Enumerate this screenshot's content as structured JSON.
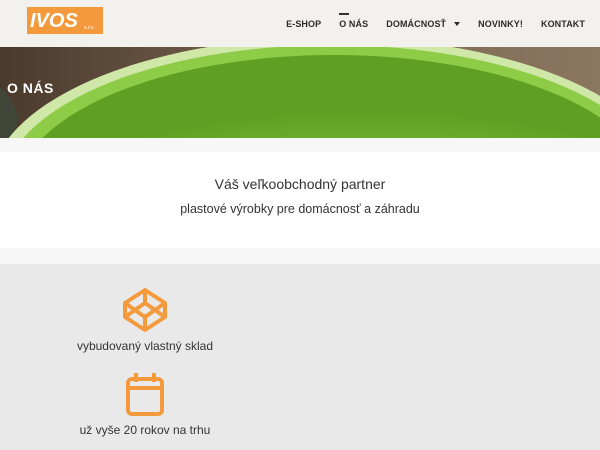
{
  "header": {
    "logo_text": "IVOS",
    "logo_suffix": "s.r.o.",
    "nav": [
      {
        "label": "E-SHOP"
      },
      {
        "label": "O NÁS"
      },
      {
        "label": "DOMÁCNOSŤ"
      },
      {
        "label": "NOVINKY!"
      },
      {
        "label": "KONTAKT"
      }
    ]
  },
  "hero": {
    "title": "O NÁS"
  },
  "intro": {
    "line1": "Váš veľkoobchodný partner",
    "line2": "plastové výrobky pre domácnosť a záhradu"
  },
  "features": [
    {
      "icon": "codepen-cube-icon",
      "label": "vybudovaný vlastný sklad"
    },
    {
      "icon": "calendar-icon",
      "label": "už vyše 20 rokov na trhu"
    }
  ],
  "colors": {
    "accent": "#f39a3d",
    "bowl_green": "#7fc13a",
    "header_bg": "#f3f1ee",
    "section_bg": "#e9e9e9"
  }
}
